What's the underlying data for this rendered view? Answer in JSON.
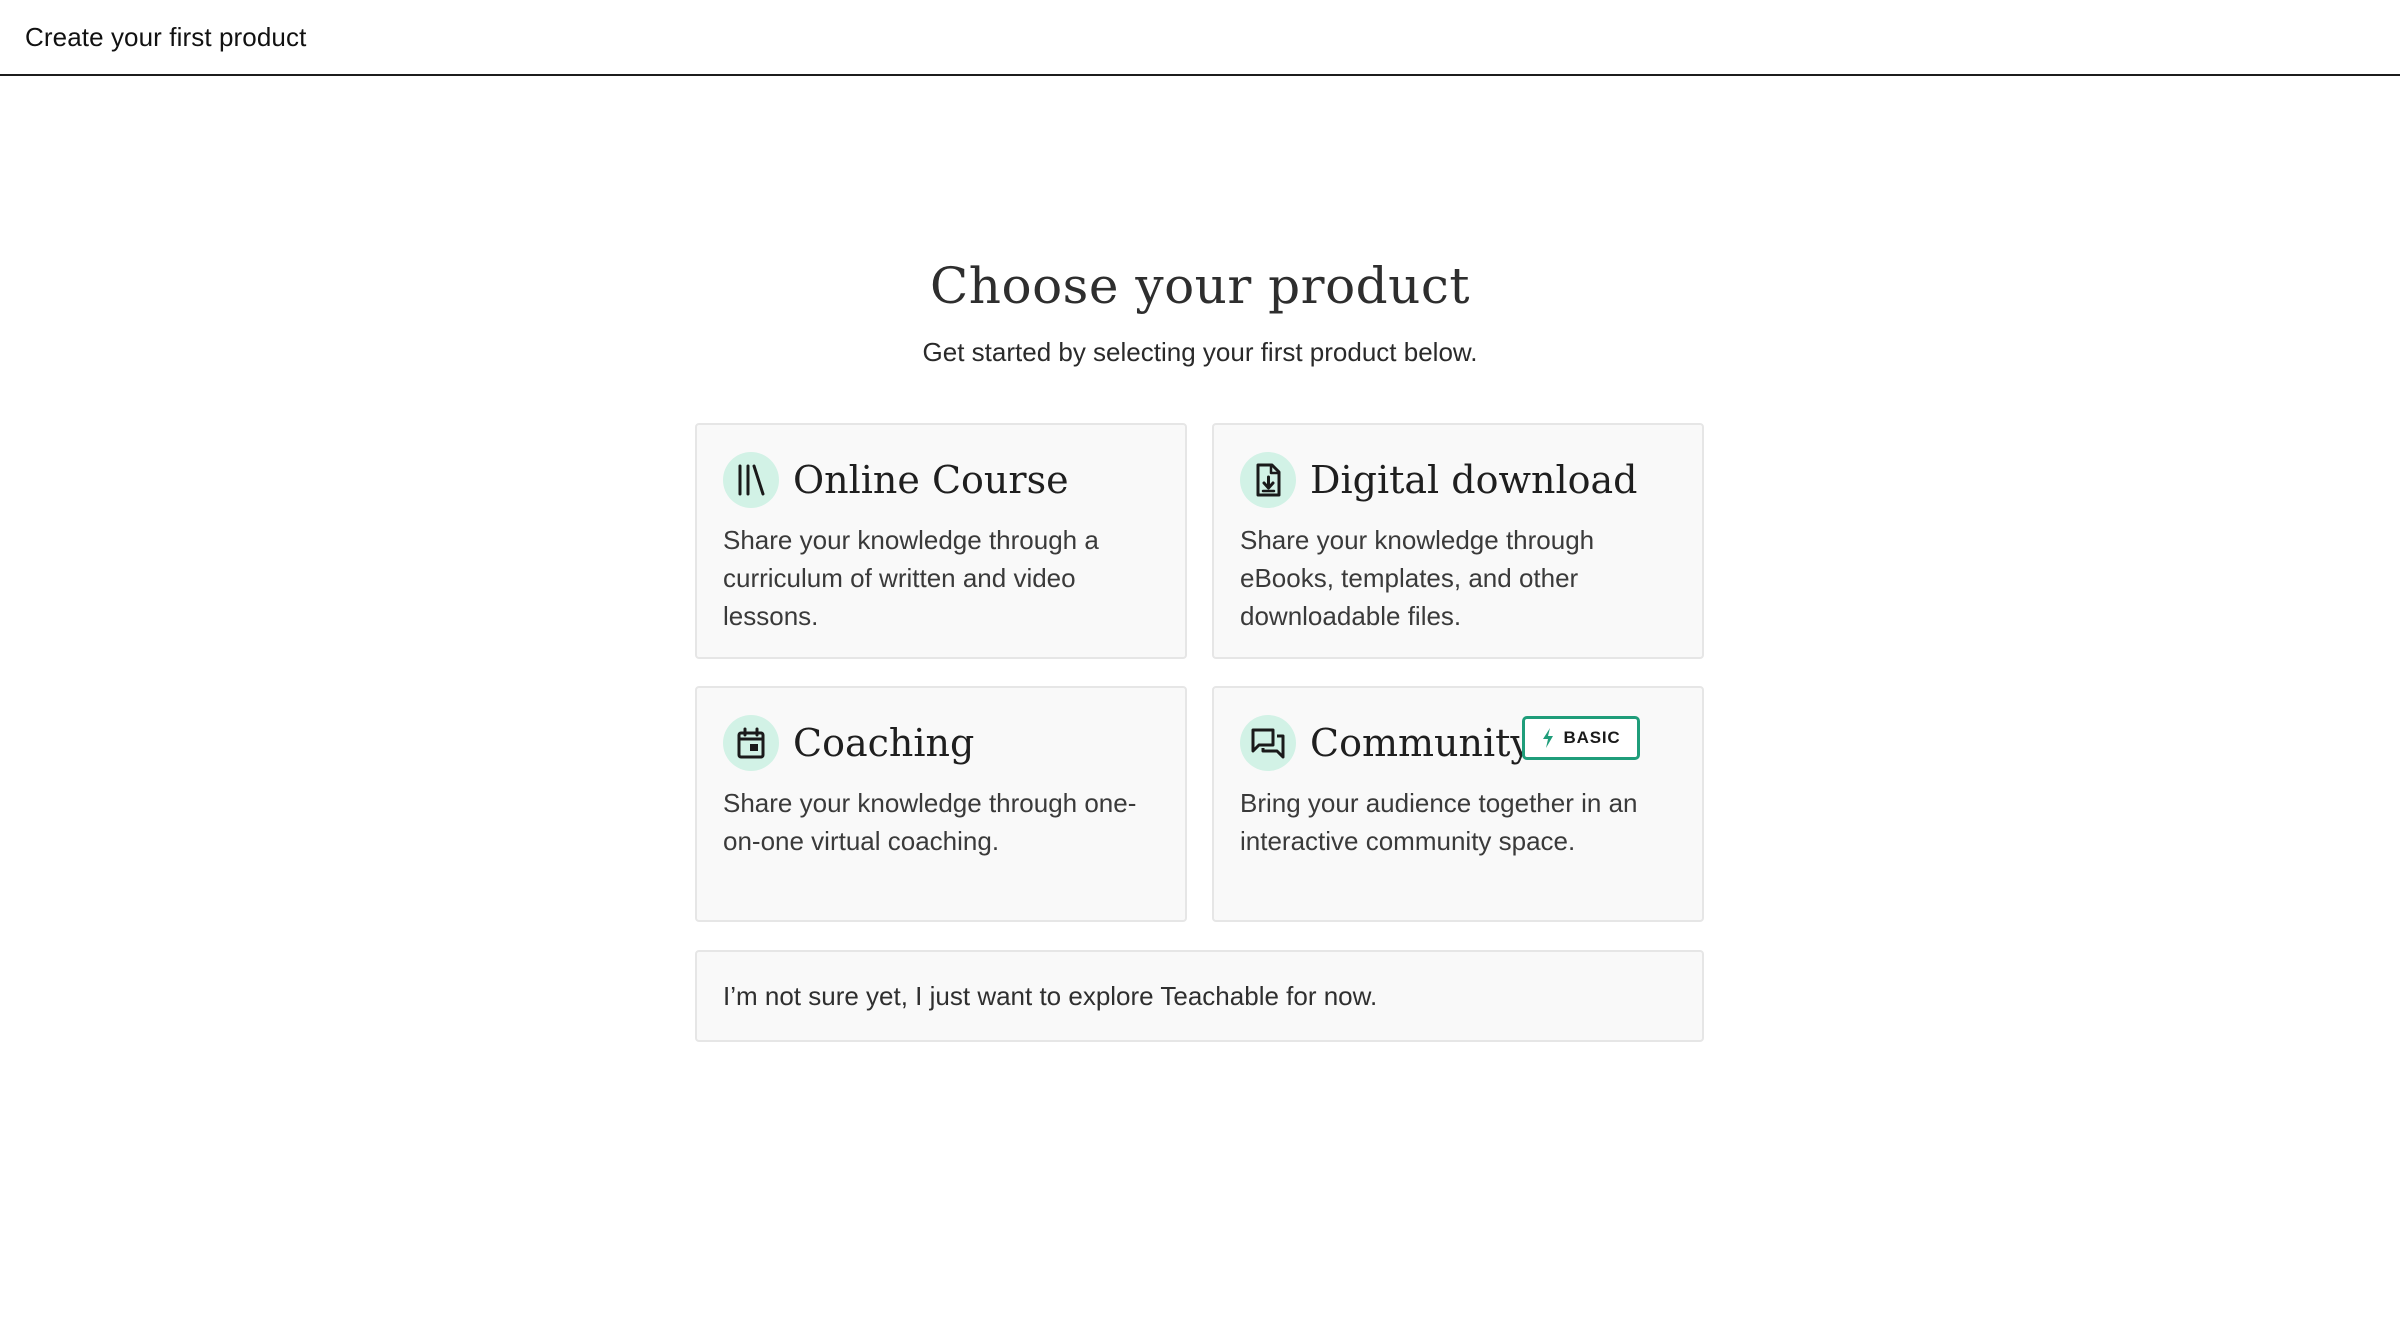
{
  "header": {
    "title": "Create your first product"
  },
  "main": {
    "title": "Choose your product",
    "subtitle": "Get started by selecting your first product below.",
    "products": [
      {
        "title": "Online Course",
        "description": "Share your knowledge through a curriculum of written and video lessons.",
        "icon": "library-books-icon"
      },
      {
        "title": "Digital download",
        "description": "Share your knowledge through eBooks, templates, and other downloadable files.",
        "icon": "file-download-icon"
      },
      {
        "title": "Coaching",
        "description": "Share your knowledge through one-on-one virtual coaching.",
        "icon": "calendar-icon"
      },
      {
        "title": "Community",
        "description": "Bring your audience together in an interactive community space.",
        "icon": "chat-bubbles-icon",
        "badge": {
          "label": "BASIC",
          "icon": "lightning-bolt-icon"
        }
      }
    ],
    "explore": {
      "label": "I’m not sure yet, I just want to explore Teachable for now."
    }
  },
  "colors": {
    "icon_circle": "#d2f2e6",
    "badge_border": "#1f9d7a",
    "badge_bolt": "#1f9d7a",
    "card_background": "#f9f9f9",
    "card_border": "#e6e6e6"
  }
}
